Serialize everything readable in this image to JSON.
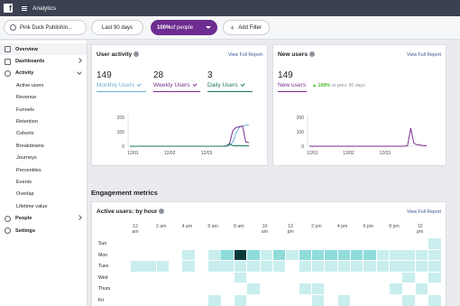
{
  "app": {
    "title": "Analytics",
    "logo": "f"
  },
  "filters": {
    "source": "Pink Duck Publishin...",
    "range": "Last 90 days",
    "people_pct": "100%",
    "people_suffix": " of people",
    "add_filter": "Add Filter"
  },
  "sidebar": {
    "overview": "Overview",
    "dashboards": "Dashboards",
    "activity": "Activity",
    "activity_items": [
      "Active users",
      "Revenue",
      "Funnels",
      "Retention",
      "Cohorts",
      "Breakdowns",
      "Journeys",
      "Percentiles",
      "Events",
      "Overlap",
      "Lifetime value"
    ],
    "people": "People",
    "settings": "Settings"
  },
  "user_activity": {
    "title": "User activity",
    "link": "View Full Report",
    "kpis": [
      {
        "value": "149",
        "label": "Monthly Users",
        "color": "#6baed6"
      },
      {
        "value": "28",
        "label": "Weekly Users",
        "color": "#7b2c8f"
      },
      {
        "value": "3",
        "label": "Daily Users",
        "color": "#1a7a5a"
      }
    ]
  },
  "new_users": {
    "title": "New users",
    "link": "View Full Report",
    "value": "149",
    "label": "New users",
    "change": "100%",
    "change_suffix": " vs prev. 90 days"
  },
  "engagement": {
    "section_title": "Engagement metrics",
    "card_title": "Active users: by hour",
    "link": "View Full Report",
    "hours_top": [
      "12\nam",
      "2 am",
      "4 am",
      "6 am",
      "8 am",
      "10\nam",
      "12\npm",
      "2 pm",
      "4 pm",
      "6 pm",
      "8 pm",
      "10\npm"
    ],
    "days": [
      "Sun",
      "Mon",
      "Tues",
      "Wed",
      "Thurs",
      "Fri"
    ]
  },
  "chart_data": [
    {
      "type": "line",
      "title": "User activity",
      "x": [
        "12/01",
        "12/02",
        "12/03"
      ],
      "ylim": [
        0,
        200
      ],
      "yticks": [
        0,
        100,
        200
      ],
      "series": [
        {
          "name": "Monthly Users",
          "color": "#6baed6",
          "values": [
            0,
            0,
            0,
            0,
            0,
            0,
            0,
            0,
            0,
            0,
            0,
            0,
            0,
            0,
            0,
            0,
            0,
            0,
            0,
            0,
            0,
            0,
            0,
            0,
            0,
            0,
            0,
            0,
            0,
            0,
            2,
            5,
            30,
            90,
            130,
            140,
            145,
            149
          ]
        },
        {
          "name": "Weekly Users",
          "color": "#7b2c8f",
          "values": [
            0,
            0,
            0,
            0,
            0,
            0,
            0,
            0,
            0,
            0,
            0,
            0,
            0,
            0,
            0,
            0,
            0,
            0,
            0,
            0,
            0,
            0,
            0,
            0,
            0,
            0,
            0,
            0,
            0,
            0,
            2,
            20,
            110,
            130,
            135,
            140,
            30,
            25
          ]
        },
        {
          "name": "Daily Users",
          "color": "#1a7a5a",
          "values": [
            0,
            0,
            0,
            0,
            0,
            0,
            0,
            0,
            0,
            0,
            0,
            0,
            0,
            0,
            0,
            0,
            0,
            0,
            0,
            0,
            0,
            0,
            0,
            0,
            0,
            0,
            0,
            0,
            0,
            0,
            2,
            15,
            5,
            3,
            5,
            4,
            3,
            3
          ]
        }
      ]
    },
    {
      "type": "line",
      "title": "New users",
      "x": [
        "12/01",
        "12/02",
        "12/03"
      ],
      "ylim": [
        0,
        200
      ],
      "yticks": [
        0,
        100,
        200
      ],
      "series": [
        {
          "name": "New users",
          "color": "#7b2c8f",
          "values": [
            0,
            0,
            0,
            0,
            0,
            0,
            0,
            0,
            0,
            0,
            0,
            0,
            0,
            0,
            0,
            0,
            0,
            0,
            0,
            0,
            0,
            0,
            0,
            0,
            0,
            0,
            0,
            0,
            0,
            0,
            0,
            5,
            125,
            20,
            10,
            8,
            5,
            3
          ]
        }
      ]
    },
    {
      "type": "heatmap",
      "title": "Active users: by hour",
      "rows": [
        "Sun",
        "Mon",
        "Tues",
        "Wed",
        "Thurs",
        "Fri"
      ],
      "cols": 24,
      "values": [
        [
          0,
          0,
          0,
          0,
          0,
          0,
          0,
          0,
          0,
          0,
          0,
          0,
          0,
          0,
          0,
          0,
          0,
          0,
          0,
          0,
          0,
          0,
          0,
          1
        ],
        [
          0,
          0,
          0,
          0,
          1,
          0,
          1,
          2,
          4,
          2,
          1,
          2,
          1,
          2,
          2,
          2,
          2,
          2,
          2,
          1,
          1,
          1,
          1,
          1
        ],
        [
          1,
          1,
          1,
          0,
          1,
          0,
          1,
          1,
          1,
          1,
          1,
          1,
          0,
          1,
          1,
          1,
          1,
          1,
          1,
          1,
          1,
          1,
          1,
          1
        ],
        [
          0,
          0,
          0,
          0,
          0,
          0,
          0,
          0,
          1,
          0,
          0,
          0,
          0,
          0,
          0,
          0,
          0,
          0,
          0,
          0,
          0,
          1,
          0,
          1
        ],
        [
          0,
          0,
          0,
          0,
          0,
          0,
          0,
          0,
          0,
          1,
          0,
          0,
          0,
          1,
          1,
          0,
          0,
          0,
          0,
          0,
          1,
          0,
          1,
          0
        ],
        [
          0,
          0,
          0,
          0,
          0,
          0,
          1,
          0,
          1,
          0,
          0,
          0,
          0,
          0,
          1,
          0,
          1,
          0,
          0,
          0,
          0,
          1,
          0,
          1
        ]
      ],
      "colors": [
        "#ffffff",
        "#c9eeee",
        "#8fdcdb",
        "#4cbfbd",
        "#0b3a3a"
      ]
    }
  ]
}
